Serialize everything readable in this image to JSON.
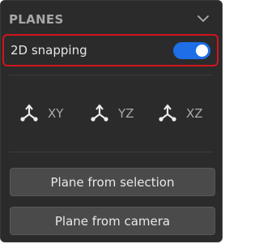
{
  "panel": {
    "title": "PLANES",
    "collapse_icon": "chevron-down-icon"
  },
  "snapping": {
    "label": "2D snapping",
    "enabled": true,
    "accent_color": "#1e6ee8",
    "highlight_color": "#d0151c"
  },
  "planes": [
    {
      "label": "XY",
      "icon": "axis-tripod-icon"
    },
    {
      "label": "YZ",
      "icon": "axis-tripod-icon"
    },
    {
      "label": "XZ",
      "icon": "axis-tripod-icon"
    }
  ],
  "actions": {
    "plane_from_selection": "Plane from selection",
    "plane_from_camera": "Plane from camera"
  }
}
